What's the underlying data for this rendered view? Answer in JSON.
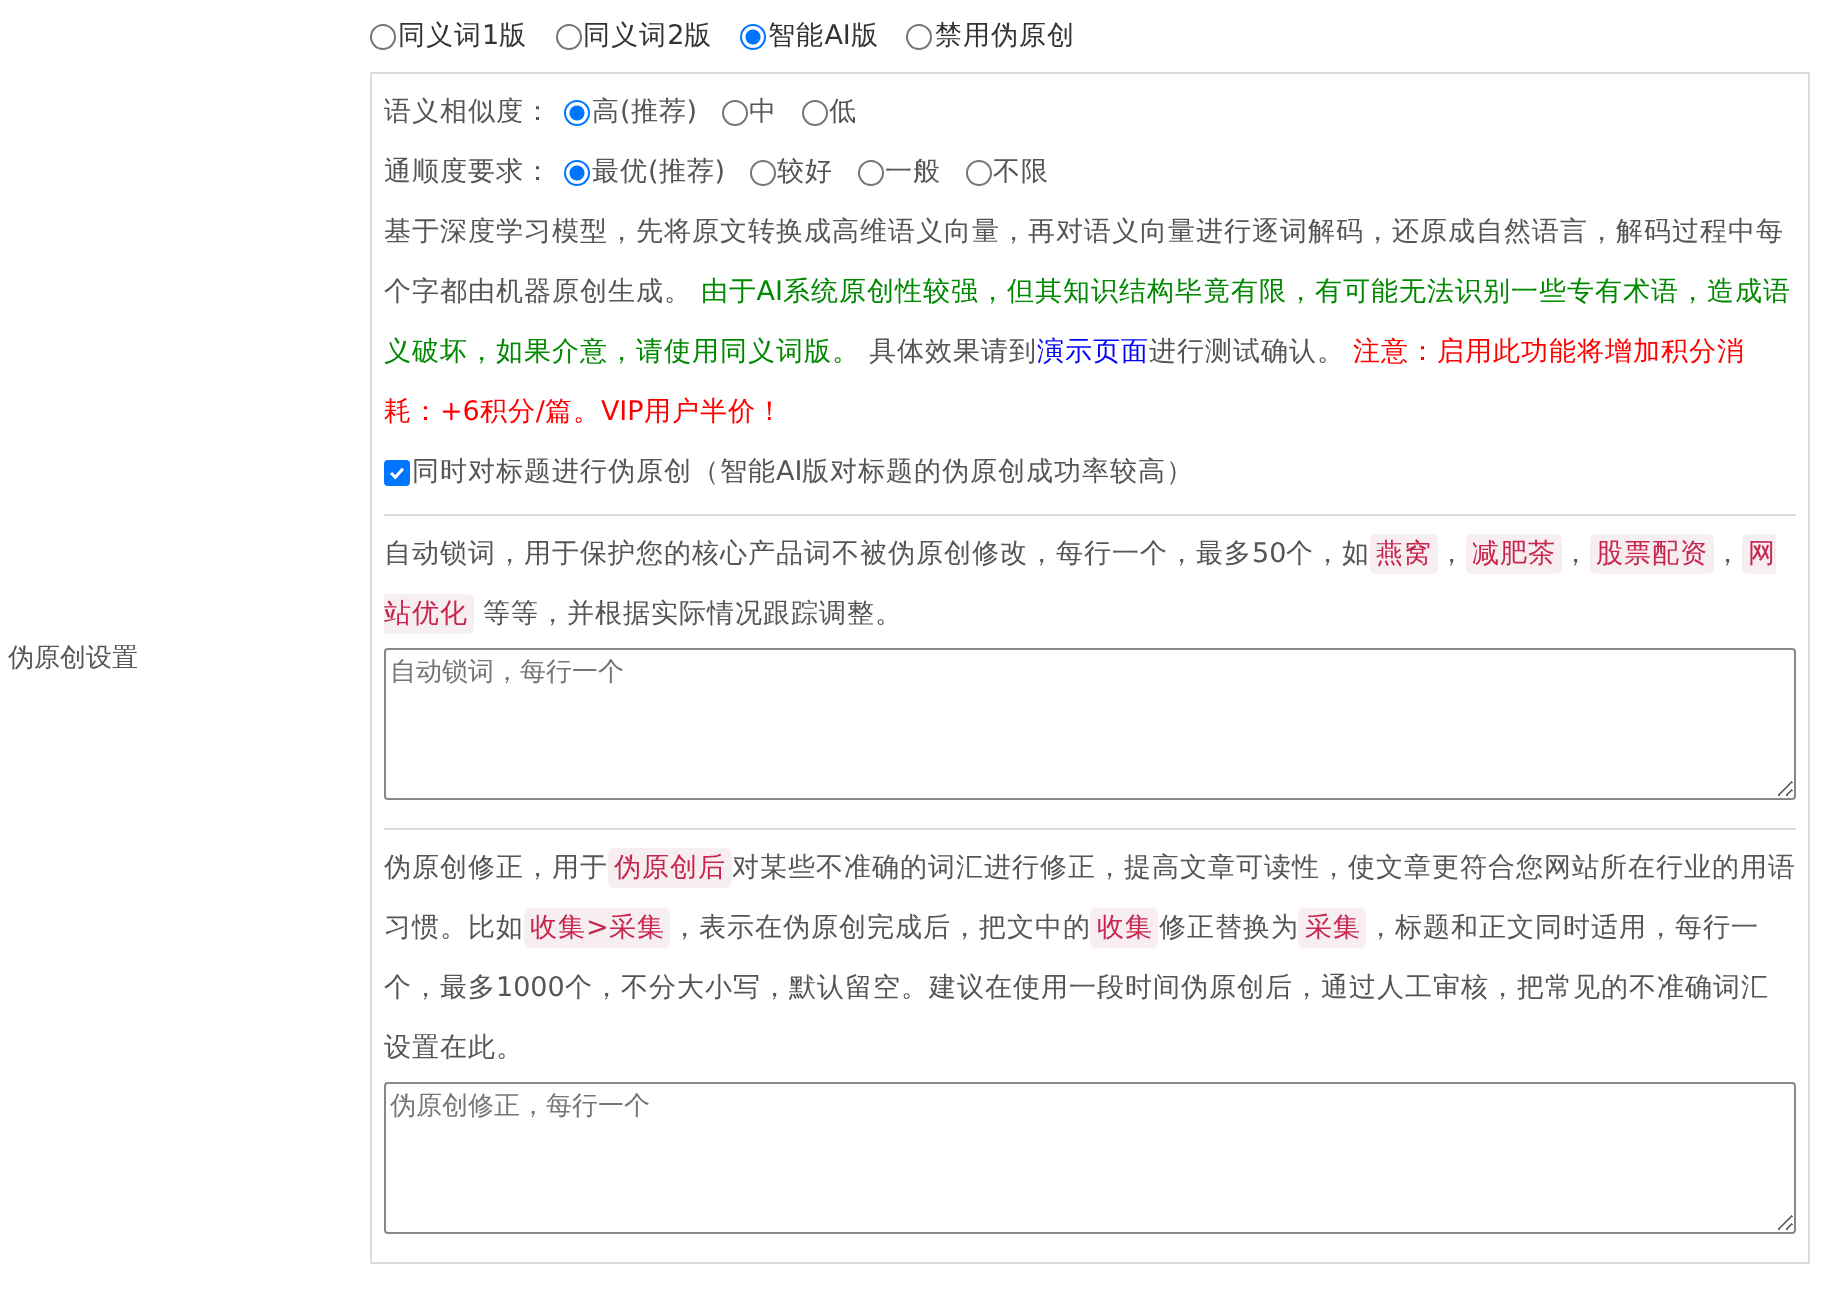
{
  "setting_label": "伪原创设置",
  "modes": [
    {
      "label": "同义词1版",
      "selected": false
    },
    {
      "label": "同义词2版",
      "selected": false
    },
    {
      "label": "智能AI版",
      "selected": true
    },
    {
      "label": "禁用伪原创",
      "selected": false
    }
  ],
  "similarity": {
    "label": "语义相似度：",
    "options": [
      {
        "label": "高(推荐)",
        "selected": true
      },
      {
        "label": "中",
        "selected": false
      },
      {
        "label": "低",
        "selected": false
      }
    ]
  },
  "fluency": {
    "label": "通顺度要求：",
    "options": [
      {
        "label": "最优(推荐)",
        "selected": true
      },
      {
        "label": "较好",
        "selected": false
      },
      {
        "label": "一般",
        "selected": false
      },
      {
        "label": "不限",
        "selected": false
      }
    ]
  },
  "description": [
    {
      "kind": "text",
      "text": "基于深度学习模型，先将原文转换成高维语义向量，再对语义向量进行逐词解码，还原成自然语言，解码过程中每个字都由机器原创生成。 "
    },
    {
      "kind": "notice",
      "text": "由于AI系统原创性较强，但其知识结构毕竟有限，有可能无法识别一些专有术语，造成语义破坏，如果介意，请使用同义词版。"
    },
    {
      "kind": "text",
      "text": " 具体效果请到"
    },
    {
      "kind": "link",
      "text": "演示页面"
    },
    {
      "kind": "text",
      "text": "进行测试确认。 "
    },
    {
      "kind": "warning",
      "text": "注意：启用此功能将增加积分消耗：+6积分/篇。VIP用户半价！"
    }
  ],
  "title_option": {
    "label": "同时对标题进行伪原创（智能AI版对标题的伪原创成功率较高）",
    "checked": true
  },
  "lock_words": {
    "description": [
      {
        "kind": "text",
        "text": "自动锁词，用于保护您的核心产品词不被伪原创修改，每行一个，最多50个，如"
      },
      {
        "kind": "tag",
        "text": "燕窝"
      },
      {
        "kind": "text",
        "text": "，"
      },
      {
        "kind": "tag",
        "text": "减肥茶"
      },
      {
        "kind": "text",
        "text": "，"
      },
      {
        "kind": "tag",
        "text": "股票配资"
      },
      {
        "kind": "text",
        "text": "，"
      },
      {
        "kind": "tag",
        "text": "网站优化"
      },
      {
        "kind": "text",
        "text": " 等等，并根据实际情况跟踪调整。"
      }
    ],
    "placeholder": "自动锁词，每行一个"
  },
  "corrections": {
    "description": [
      {
        "kind": "text",
        "text": "伪原创修正，用于"
      },
      {
        "kind": "tag",
        "text": "伪原创后"
      },
      {
        "kind": "text",
        "text": "对某些不准确的词汇进行修正，提高文章可读性，使文章更符合您网站所在行业的用语习惯。比如"
      },
      {
        "kind": "tag",
        "text": "收集>采集"
      },
      {
        "kind": "text",
        "text": "，表示在伪原创完成后，把文中的"
      },
      {
        "kind": "tag",
        "text": "收集"
      },
      {
        "kind": "text",
        "text": "修正替换为"
      },
      {
        "kind": "tag",
        "text": "采集"
      },
      {
        "kind": "text",
        "text": "，标题和正文同时适用，每行一个，最多1000个，不分大小写，默认留空。建议在使用一段时间伪原创后，通过人工审核，把常见的不准确词汇设置在此。"
      }
    ],
    "placeholder": "伪原创修正，每行一个"
  }
}
